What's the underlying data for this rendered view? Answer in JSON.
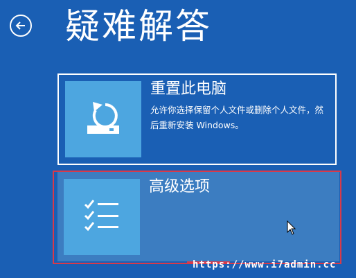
{
  "header": {
    "title": "疑难解答"
  },
  "options": [
    {
      "label": "重置此电脑",
      "description": "允许你选择保留个人文件或删除个人文件，然后重新安装 Windows。",
      "icon": "reset-pc-icon"
    },
    {
      "label": "高级选项",
      "icon": "checklist-icon"
    }
  ],
  "watermark": "https://www.i7admin.cc",
  "colors": {
    "background": "#1a5fb4",
    "tile": "#4da6e0",
    "selected": "#3c7dc1",
    "highlight_border": "#d83a4a"
  }
}
